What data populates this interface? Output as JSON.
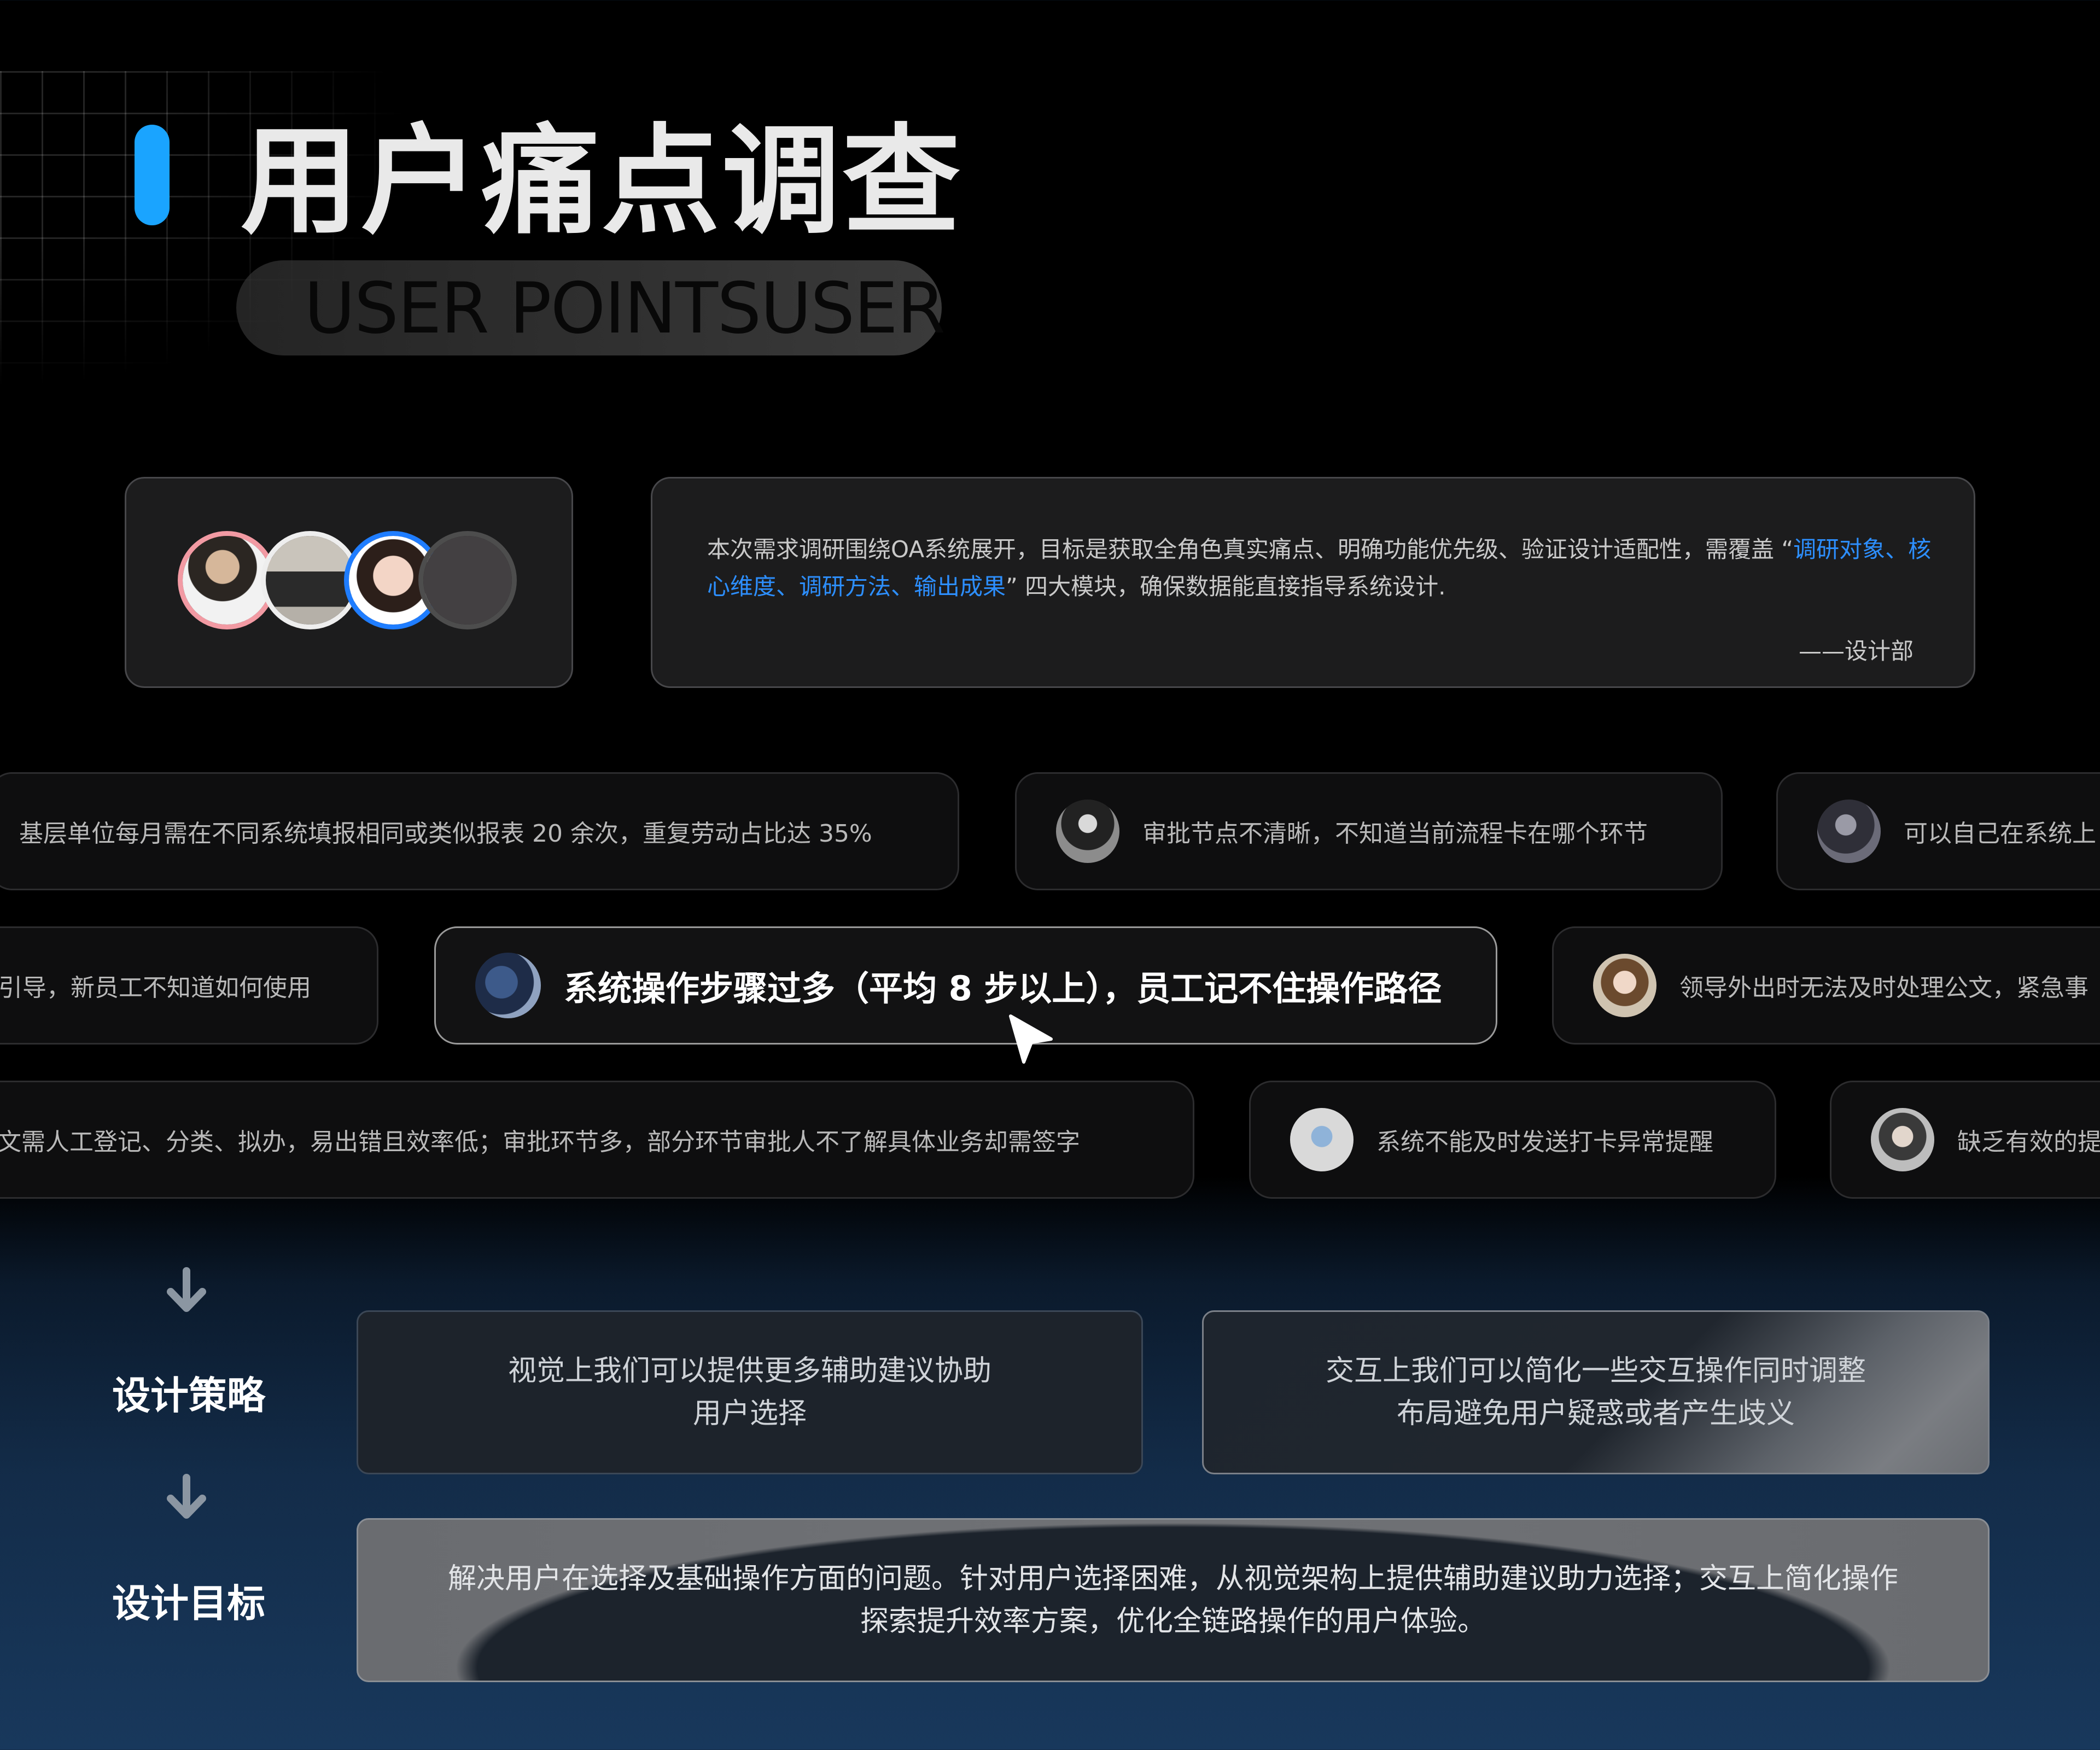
{
  "header": {
    "title": "用户痛点调查",
    "subtitle": "USER POINTSUSER"
  },
  "intro": {
    "text_before": "本次需求调研围绕OA系统展开，目标是获取全角色真实痛点、明确功能优先级、验证设计适配性，需覆盖 “",
    "highlight": "调研对象、核心维度、调研方法、输出成果",
    "text_after": "” 四大模块，确保数据能直接指导系统设计.",
    "author": "——设计部",
    "accent_color": "#2d8fff"
  },
  "avatars": [
    {
      "icon": "user-avatar-icon",
      "ring_color": "#f29aa3"
    },
    {
      "icon": "user-avatar-icon",
      "ring_color": "#eeeeee"
    },
    {
      "icon": "user-avatar-icon",
      "ring_color": "#1f7dff"
    },
    {
      "icon": "user-avatar-icon",
      "ring_color": "#4d4d4d"
    }
  ],
  "pain_points": {
    "row1": [
      "基层单位每月需在不同系统填报相同或类似报表 20 余次，重复劳动占比达 35%",
      "审批节点不清晰，不知道当前流程卡在哪个环节",
      "可以自己在系统上"
    ],
    "row2": [
      "引导，新员工不知道如何使用",
      "系统操作步骤过多（平均 8 步以上），员工记不住操作路径",
      "领导外出时无法及时处理公文，紧急事"
    ],
    "row3": [
      "文需人工登记、分类、拟办，易出错且效率低；审批环节多，部分环节审批人不了解具体业务却需签字",
      "系统不能及时发送打卡异常提醒",
      "缺乏有效的提"
    ]
  },
  "strategy": {
    "label": "设计策略",
    "visual_text": "视觉上我们可以提供更多辅助建议协助\n用户选择",
    "interaction_text": "交互上我们可以简化一些交互操作同时调整\n布局避免用户疑惑或者产生歧义"
  },
  "goal": {
    "label": "设计目标",
    "text": "解决用户在选择及基础操作方面的问题。针对用户选择困难，从视觉架构上提供辅助建议助力选择；交互上简化操作\n探索提升效率方案，优化全链路操作的用户体验。"
  },
  "colors": {
    "accent_bar": "#1aa4ff",
    "background_top": "#000000",
    "background_bottom": "#18385c"
  }
}
